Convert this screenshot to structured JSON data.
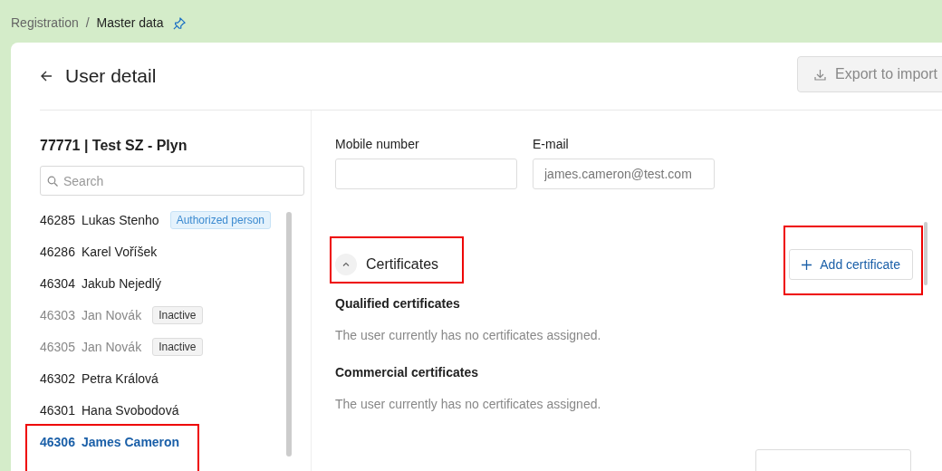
{
  "breadcrumb": {
    "items": [
      {
        "label": "Registration",
        "current": false
      },
      {
        "label": "Master data",
        "current": true
      }
    ],
    "separator": "/",
    "pinned": true
  },
  "page": {
    "title": "User detail",
    "export_button": "Export to import"
  },
  "organization": {
    "title": "77771 | Test SZ - Plyn"
  },
  "search": {
    "placeholder": "Search"
  },
  "users": [
    {
      "id": "46285",
      "name": "Lukas Stenho",
      "tag": {
        "text": "Authorized person",
        "kind": "role"
      },
      "inactive": false,
      "selected": false,
      "highlighted": false
    },
    {
      "id": "46286",
      "name": "Karel Voříšek",
      "inactive": false,
      "selected": false,
      "highlighted": false
    },
    {
      "id": "46304",
      "name": "Jakub Nejedlý",
      "inactive": false,
      "selected": false,
      "highlighted": false
    },
    {
      "id": "46303",
      "name": "Jan Novák",
      "tag": {
        "text": "Inactive",
        "kind": "status"
      },
      "inactive": true,
      "selected": false,
      "highlighted": false
    },
    {
      "id": "46305",
      "name": "Jan Novák",
      "tag": {
        "text": "Inactive",
        "kind": "status"
      },
      "inactive": true,
      "selected": false,
      "highlighted": false
    },
    {
      "id": "46302",
      "name": "Petra Králová",
      "inactive": false,
      "selected": false,
      "highlighted": false
    },
    {
      "id": "46301",
      "name": "Hana Svobodová",
      "inactive": false,
      "selected": false,
      "highlighted": false
    },
    {
      "id": "46306",
      "name": "James Cameron",
      "inactive": false,
      "selected": true,
      "highlighted": true
    }
  ],
  "contact": {
    "fields": [
      {
        "label": "Mobile number"
      },
      {
        "label": "E-mail",
        "value": "james.cameron@test.com"
      }
    ]
  },
  "certificates": {
    "title": "Certificates",
    "expanded": true,
    "highlighted": true,
    "add_button": {
      "label": "Add certificate",
      "highlighted": true
    },
    "groups": [
      {
        "title": "Qualified certificates",
        "empty_text": "The user currently has no certificates assigned."
      },
      {
        "title": "Commercial certificates",
        "empty_text": "The user currently has no certificates assigned."
      }
    ]
  }
}
